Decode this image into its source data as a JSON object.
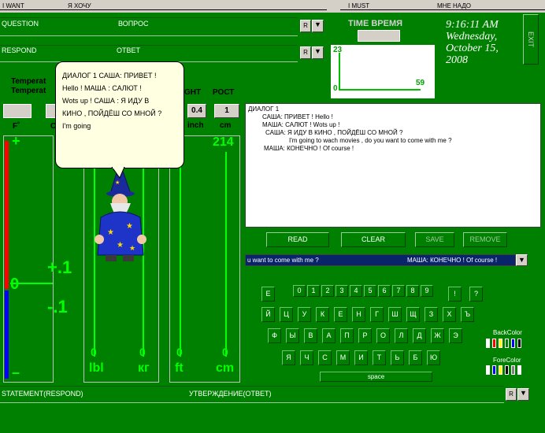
{
  "top_bar": {
    "i_want": "I WANT",
    "ya_hochu": "Я ХОЧУ",
    "i_must": "I MUST",
    "mne_nado": "МНЕ НАДО"
  },
  "question": {
    "label_en": "QUESTION",
    "label_ru": "ВОПРОС",
    "r": "R"
  },
  "respond": {
    "label_en": "RESPOND",
    "label_ru": "ОТВЕТ",
    "r": "R"
  },
  "time_label": "TIME ВРЕМЯ",
  "clock": {
    "time": "9:16:11 AM",
    "day": "Wednesday,",
    "date": "October 15,",
    "year": "2008"
  },
  "exit": "EXIT",
  "mini_chart": {
    "top": "23",
    "left": "0",
    "right": "59"
  },
  "temperature": {
    "label1": "Temperat",
    "label2": "Temperat",
    "unit_f": "F˚",
    "unit_c": "C",
    "plus": "+",
    "minus": "–",
    "plus1": "+.1",
    "minus1": "-.1",
    "zero": "0"
  },
  "height": {
    "label_en": "GHT",
    "label_ru": "РОСТ",
    "val_inch": "0.4",
    "val_cm": "1",
    "unit_inch": "inch",
    "unit_cm": "cm",
    "top_val": "214"
  },
  "weight": {
    "zero1": "0",
    "zero2": "0",
    "unit_lbl": "lbl",
    "unit_kg": "кг"
  },
  "length": {
    "zero1": "0",
    "zero2": "0",
    "unit_ft": "ft",
    "unit_cm": "cm"
  },
  "balloon": [
    "ДИАЛОГ 1 САША: ПРИВЕТ !",
    "Hello ! МАША : САЛЮТ !",
    "Wots up ! САША : Я ИДУ В",
    "КИНО , ПОЙДЁШ СО МНОЙ ?",
    "I'm going"
  ],
  "dialog": {
    "title": "ДИАЛОГ 1",
    "lines": [
      "САША:  ПРИВЕТ !      Hello !",
      "МАША: САЛЮТ !       Wots up !",
      "САША:  Я ИДУ В КИНО , ПОЙДЁШ СО МНОЙ ?",
      "I'm going to wach movies , do you want to come with me ?",
      "МАША:  КОНЕЧНО !   Of course !"
    ]
  },
  "buttons": {
    "read": "READ",
    "clear": "CLEAR",
    "save": "SAVE",
    "remove": "REMOVE"
  },
  "combo": {
    "left": "u want to come with me ?",
    "right": "МАША:  КОНЕЧНО !   Of course !"
  },
  "keyboard": {
    "row0_first": "Е",
    "digits": [
      "0",
      "1",
      "2",
      "3",
      "4",
      "5",
      "6",
      "7",
      "8",
      "9"
    ],
    "row0_extra": [
      "!",
      "?"
    ],
    "row1": [
      "Й",
      "Ц",
      "У",
      "К",
      "Е",
      "Н",
      "Г",
      "Ш",
      "Щ",
      "З",
      "Х",
      "Ъ"
    ],
    "row2": [
      "Ф",
      "Ы",
      "В",
      "А",
      "П",
      "Р",
      "О",
      "Л",
      "Д",
      "Ж",
      "Э"
    ],
    "row3": [
      "Я",
      "Ч",
      "С",
      "М",
      "И",
      "Т",
      "Ь",
      "Б",
      "Ю"
    ],
    "space": "space"
  },
  "back_color": {
    "label": "BackColor",
    "swatches": [
      "#ffffff",
      "#ff0000",
      "#ffff00",
      "#008000",
      "#0000ff",
      "#000000"
    ]
  },
  "fore_color": {
    "label": "ForeColor",
    "swatches": [
      "#ffffff",
      "#0000ff",
      "#ffff00",
      "#000000",
      "#808080",
      "#ffffff"
    ]
  },
  "statement": {
    "label_en": "STATEMENT(RESPOND)",
    "label_ru": "УТВЕРЖДЕНИЕ(ОТВЕТ)",
    "r": "R"
  }
}
